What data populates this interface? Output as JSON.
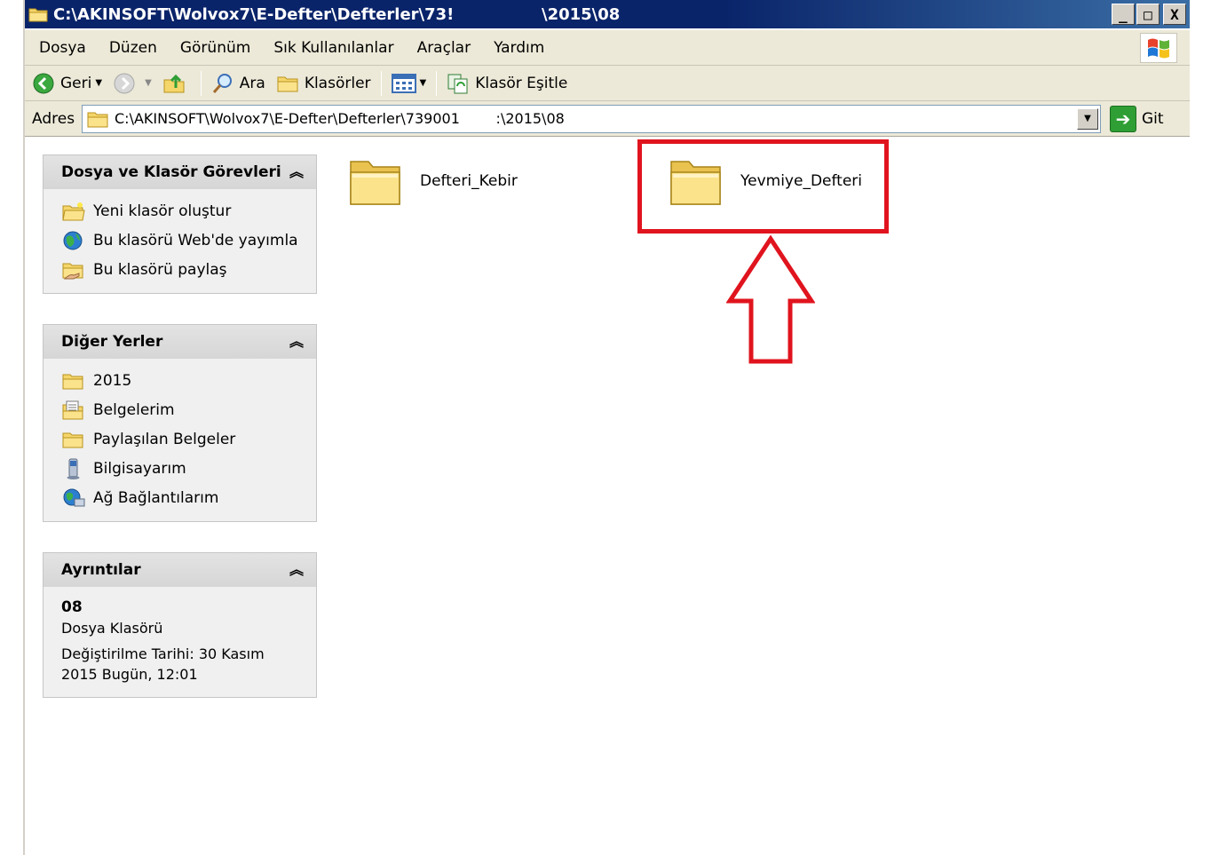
{
  "window": {
    "title_left": "C:\\AKINSOFT\\Wolvox7\\E-Defter\\Defterler\\73!",
    "title_right": "\\2015\\08",
    "minimize": "_",
    "maximize": "□",
    "close": "X"
  },
  "menu": [
    "Dosya",
    "Düzen",
    "Görünüm",
    "Sık Kullanılanlar",
    "Araçlar",
    "Yardım"
  ],
  "toolbar": {
    "back": "Geri",
    "search": "Ara",
    "folders": "Klasörler",
    "sync": "Klasör Eşitle"
  },
  "address": {
    "label": "Adres",
    "value": "C:\\AKINSOFT\\Wolvox7\\E-Defter\\Defterler\\739001        :\\2015\\08",
    "go": "Git"
  },
  "tasks_panel": {
    "title": "Dosya ve Klasör Görevleri",
    "items": [
      "Yeni klasör oluştur",
      "Bu klasörü Web'de yayımla",
      "Bu klasörü paylaş"
    ]
  },
  "places_panel": {
    "title": "Diğer Yerler",
    "items": [
      "2015",
      "Belgelerim",
      "Paylaşılan Belgeler",
      "Bilgisayarım",
      "Ağ Bağlantılarım"
    ]
  },
  "details_panel": {
    "title": "Ayrıntılar",
    "name": "08",
    "type": "Dosya Klasörü",
    "modified_1": "Değiştirilme Tarihi: 30 Kasım",
    "modified_2": "2015 Bugün, 12:01"
  },
  "folders": [
    "Defteri_Kebir",
    "Yevmiye_Defteri"
  ],
  "colors": {
    "titlebar": "#0a246a",
    "highlight": "#e0141e",
    "chrome": "#ece9d8",
    "folder": "#f5d66b"
  }
}
